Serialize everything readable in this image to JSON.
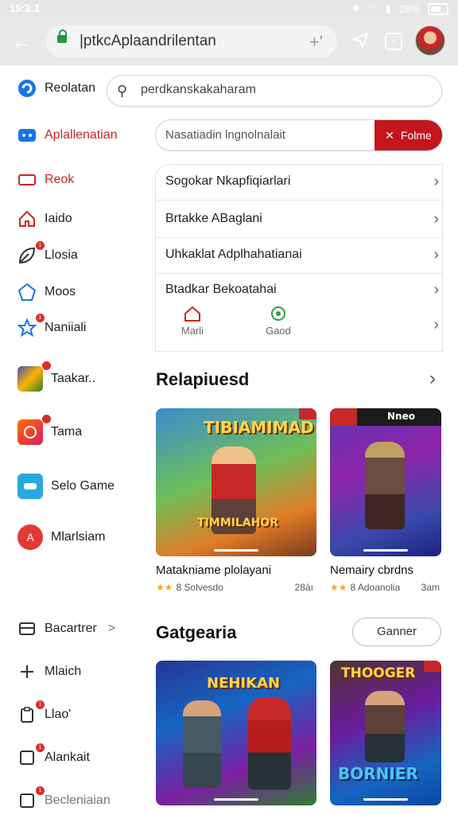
{
  "status": {
    "time": "15:3:3",
    "battery": "28%"
  },
  "url": {
    "text": "|ptkcAplaandrilentan",
    "plus": "+'"
  },
  "sidebar": {
    "items": [
      {
        "label": "Reolatan",
        "icon": "browser-icon",
        "color": "#1a73e8"
      },
      {
        "label": "Aplallenatian",
        "icon": "apps-icon",
        "color": "#c62828"
      },
      {
        "label": "Reok",
        "icon": "rectangle-icon",
        "color": "#c62828"
      },
      {
        "label": "Iaido",
        "icon": "home-icon",
        "color": "#c62828"
      },
      {
        "label": "Llosia",
        "icon": "leaf-icon",
        "color": "#333",
        "badge": "1"
      },
      {
        "label": "Moos",
        "icon": "shape-icon",
        "color": "#1a73e8"
      },
      {
        "label": "Naniiali",
        "icon": "star-outline-icon",
        "color": "#1a73e8",
        "badge": "1"
      }
    ],
    "apps": [
      {
        "label": "Taakar..",
        "icon": "game-tile-icon"
      },
      {
        "label": "Tama",
        "icon": "camera-app-icon"
      },
      {
        "label": "Selo Game",
        "icon": "controller-app-icon"
      },
      {
        "label": "Mlarlsiam",
        "icon": "red-app-icon"
      }
    ],
    "bottom": [
      {
        "label": "Bacartrer",
        "icon": "folder-icon",
        "chevron": ">"
      },
      {
        "label": "Mlaich",
        "icon": "pin-icon"
      },
      {
        "label": "Llao'",
        "icon": "clipboard-icon",
        "badge": "1"
      },
      {
        "label": "Alankait",
        "icon": "checkbox-icon",
        "badge": "1"
      },
      {
        "label": "Becleniaian",
        "icon": "checkbox-icon",
        "badge": "1"
      }
    ]
  },
  "search": {
    "text": "perdkanskakaharam"
  },
  "filter": {
    "placeholder": "Nasatiadin lngnolnalait",
    "button": "Folme"
  },
  "dropdown": {
    "rows": [
      "Sogokar Nkapfiqiarlari",
      "Brtakke ABaglani",
      "Uhkaklat Adplhahatianai",
      "Btadkar Bekoatahai"
    ],
    "tabs": [
      {
        "label": "Marli",
        "icon": "home-icon"
      },
      {
        "label": "Gaod",
        "icon": "target-icon"
      }
    ]
  },
  "section1": {
    "title": "Relapiuesd",
    "cards": [
      {
        "title": "Matakniame plolayani",
        "rating": "8 Solvesdo",
        "size": "28áı",
        "art": "TIBIAMIMAD",
        "art2": "TIMMILAHOR"
      },
      {
        "title": "Nemairy cbrdns",
        "rating": "8 Adoanolia",
        "size": "3am",
        "art": "Nneo"
      }
    ]
  },
  "section2": {
    "title": "Gatgearia",
    "button": "Ganner",
    "cards": [
      {
        "art": "NEHIKAN"
      },
      {
        "art": "THOOGER",
        "art2": "BORNIER"
      }
    ]
  }
}
